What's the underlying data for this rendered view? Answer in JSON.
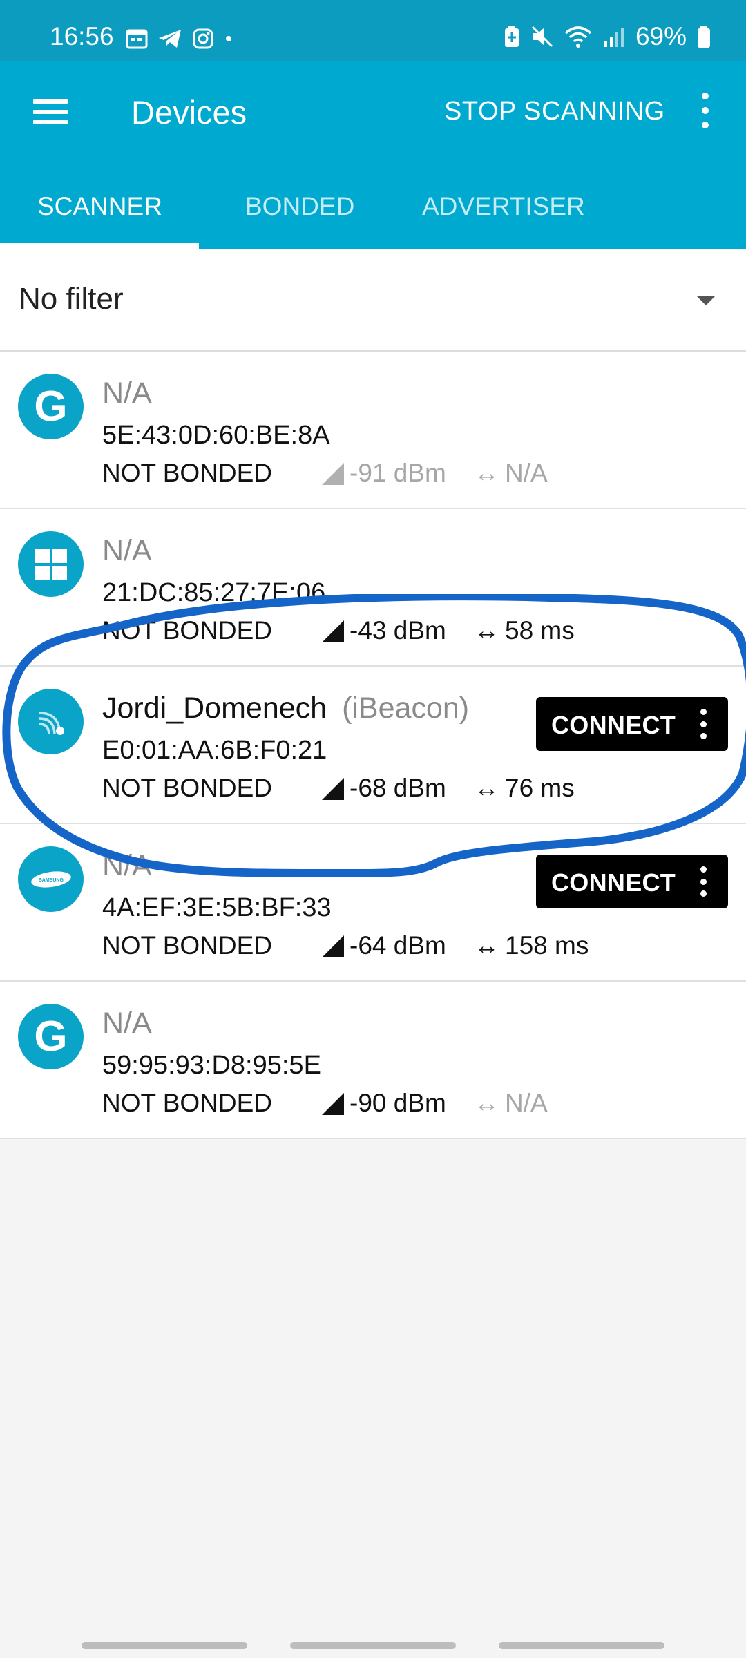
{
  "status_bar": {
    "time": "16:56",
    "battery": "69%",
    "left_icons": [
      "calendar-icon",
      "telegram-icon",
      "instagram-icon",
      "dot-icon"
    ],
    "right_icons": [
      "battery-saver-icon",
      "mute-icon",
      "wifi-icon",
      "signal-icon",
      "battery-icon"
    ]
  },
  "app_bar": {
    "title": "Devices",
    "action_label": "STOP SCANNING"
  },
  "tabs": [
    {
      "label": "SCANNER",
      "active": true
    },
    {
      "label": "BONDED",
      "active": false
    },
    {
      "label": "ADVERTISER",
      "active": false
    }
  ],
  "filter": {
    "label": "No filter"
  },
  "devices": [
    {
      "name": "N/A",
      "type": "",
      "address": "5E:43:0D:60:BE:8A",
      "bond_state": "NOT BONDED",
      "rssi": "-91 dBm",
      "interval": "N/A",
      "icon": "google-icon",
      "connectable": false
    },
    {
      "name": "N/A",
      "type": "",
      "address": "21:DC:85:27:7E:06",
      "bond_state": "NOT BONDED",
      "rssi": "-43 dBm",
      "interval": "58 ms",
      "icon": "windows-icon",
      "connectable": false
    },
    {
      "name": "Jordi_Domenech",
      "type": "(iBeacon)",
      "address": "E0:01:AA:6B:F0:21",
      "bond_state": "NOT BONDED",
      "rssi": "-68 dBm",
      "interval": "76 ms",
      "icon": "beacon-icon",
      "connectable": true,
      "connect_label": "CONNECT"
    },
    {
      "name": "N/A",
      "type": "",
      "address": "4A:EF:3E:5B:BF:33",
      "bond_state": "NOT BONDED",
      "rssi": "-64 dBm",
      "interval": "158 ms",
      "icon": "samsung-icon",
      "connectable": true,
      "connect_label": "CONNECT"
    },
    {
      "name": "N/A",
      "type": "",
      "address": "59:95:93:D8:95:5E",
      "bond_state": "NOT BONDED",
      "rssi": "-90 dBm",
      "interval": "N/A",
      "icon": "google-icon",
      "connectable": false
    }
  ],
  "colors": {
    "primary": "#00a9cf",
    "status_bar": "#0b9cbf",
    "avatar": "#0aa4c8",
    "annotation": "#1565c8",
    "connect_button": "#000000"
  }
}
